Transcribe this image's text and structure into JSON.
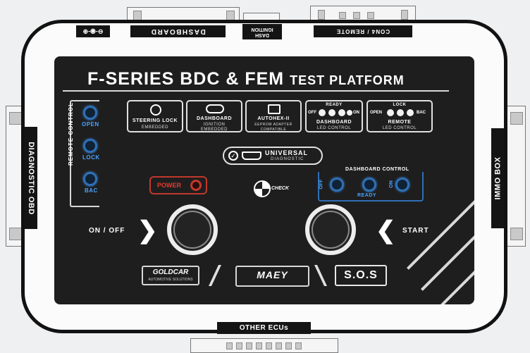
{
  "top_connectors": {
    "power_label": "⊖-◉-⊕",
    "dashboard_label": "DASHBOARD",
    "dash_ignition_line1": "DASH",
    "dash_ignition_line2": "IGNITION",
    "conn_remote_label": "CON4 / REMOTE"
  },
  "side_labels": {
    "left": "DIAGNOSTIC OBD",
    "right": "IMMO BOX"
  },
  "bottom_label": "OTHER ECUs",
  "panel": {
    "title_main": "F-SERIES BDC & FEM",
    "title_sub": "TEST PLATFORM",
    "remote_control_label": "REMOTE CONTROL",
    "remote_buttons": [
      "OPEN",
      "LOCK",
      "BAC"
    ],
    "tiles": [
      {
        "line1": "STEERING LOCK",
        "line2": "EMBEDDED"
      },
      {
        "line1": "DASHBOARD",
        "line2": "IGNITION",
        "line3": "EMBEDDED"
      },
      {
        "line1": "AUTOHEX-II",
        "line2": "EEPROM ADAPTER",
        "line3": "COMPATIBLE"
      },
      {
        "top": "READY",
        "left": "OFF",
        "right": "ON",
        "line1": "DASHBOARD",
        "line2": "LED CONTROL"
      },
      {
        "top": "LOCK",
        "left": "OPEN",
        "right": "BAC",
        "line1": "REMOTE",
        "line2": "LED CONTROL"
      }
    ],
    "universal_line1": "UNIVERSAL",
    "universal_line2": "DIAGNOSTIC",
    "power_label": "POWER",
    "check_label": "CHECK",
    "dash_control_label": "DASHBOARD CONTROL",
    "dash_control_buttons": [
      "OFF",
      "READY",
      "ON"
    ],
    "on_off_label": "ON / OFF",
    "start_label": "START",
    "logos": {
      "left_line1": "GOLDCAR",
      "left_line2": "AUTOMOTIVE SOLUTIONS",
      "middle": "MAEY",
      "right": "S.O.S"
    }
  },
  "colors": {
    "panel": "#1e1e1f",
    "accent_blue": "#2f6fb5",
    "power_red": "#c0392b"
  }
}
